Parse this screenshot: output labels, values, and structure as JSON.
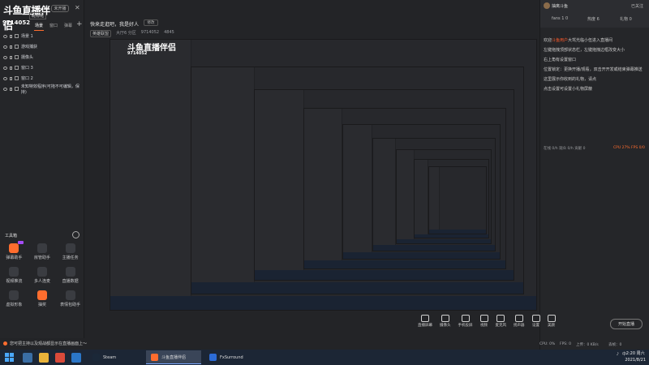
{
  "app": {
    "logo_text": "斗鱼直播伴侣",
    "status_chip": "未开播",
    "user_name": "昵称呢",
    "room_id": "9714052",
    "close_glyph": "✕"
  },
  "scene_tabs": [
    "场景",
    "窗口",
    "弹幕"
  ],
  "add_scene_glyph": "+",
  "sources": [
    {
      "label": "场景 1"
    },
    {
      "label": "游戏捕获"
    },
    {
      "label": "摄像头"
    },
    {
      "label": "窗口 3"
    },
    {
      "label": "窗口 2"
    },
    {
      "label": "未知特效程序(可拖不可编辑，保持)"
    }
  ],
  "toolbox": {
    "title": "工具箱",
    "tools": [
      {
        "label": "弹幕助手",
        "hot": true,
        "badge": true
      },
      {
        "label": "房管助手",
        "hot": false,
        "badge": false
      },
      {
        "label": "主播任务",
        "hot": false,
        "badge": false
      },
      {
        "label": "视频推流",
        "hot": false,
        "badge": false
      },
      {
        "label": "多人连麦",
        "hot": false,
        "badge": false
      },
      {
        "label": "直播数据",
        "hot": false,
        "badge": false
      },
      {
        "label": "虚拟形象",
        "hot": false,
        "badge": false
      },
      {
        "label": "抽奖",
        "hot": true,
        "badge": false
      },
      {
        "label": "表情包助手",
        "hot": false,
        "badge": false
      }
    ]
  },
  "header": {
    "stream_title": "快来走逛吧，我是好人",
    "edit_label": "修改",
    "category": "英雄联盟",
    "meta_items": [
      "大厅6 分区",
      "9714052",
      "4845"
    ]
  },
  "preview": {
    "logo_text": "斗鱼直播伴侣",
    "room_id": "9714052"
  },
  "controls": [
    {
      "label": "直播屏幕",
      "icon": "screen-icon"
    },
    {
      "label": "摄像头",
      "icon": "camera-icon"
    },
    {
      "label": "手机投屏",
      "icon": "phone-icon"
    },
    {
      "label": "视频",
      "icon": "video-icon"
    },
    {
      "label": "麦克风",
      "icon": "mic-icon"
    },
    {
      "label": "扬声器",
      "icon": "speaker-icon"
    },
    {
      "label": "设置",
      "icon": "gear-icon"
    },
    {
      "label": "美颜",
      "icon": "beauty-icon"
    }
  ],
  "start_button": "开始直播",
  "stats": {
    "cpu": "CPU: 0%",
    "fps": "FPS: 0",
    "upload": "上传：0 KB/s",
    "drop": "丢帧：0"
  },
  "right": {
    "streamer": "抽离斗鱼",
    "follow": "已关注",
    "fans": "fans 1 0",
    "hot": "热度 6",
    "gift": "礼物 0"
  },
  "chat": [
    {
      "prefix": "欢迎",
      "highlight": "斗鱼用户",
      "suffix": "大驾光临小伍进入直播间"
    },
    {
      "prefix": "左键拖拽顶部状态栏，左键拖拽边框改变大小",
      "highlight": "",
      "suffix": ""
    },
    {
      "prefix": "右上角有设置窗口",
      "highlight": "",
      "suffix": ""
    },
    {
      "prefix": "位置锁定：更换开播/观看，双击开开发或结束弹幕推送",
      "highlight": "",
      "suffix": ""
    },
    {
      "prefix": "这里展示你收到的礼物，请点",
      "highlight": "",
      "suffix": ""
    },
    {
      "prefix": "点击设置可设置小礼物屏蔽",
      "highlight": "",
      "suffix": ""
    }
  ],
  "chat_stats": {
    "left": "在线 0/h  观众 0/h  贡献 0",
    "right": "CPU 27%  FPS 0/0"
  },
  "footer_tip": "您可把主持以及观战都显示在直播画面上～",
  "taskbar": {
    "apps": [
      {
        "label": "Steam",
        "color": "#1b2838",
        "active": false
      },
      {
        "label": "斗鱼直播伴侣",
        "color": "#ff6d2e",
        "active": true
      },
      {
        "label": "FxSurround",
        "color": "#2c6bd6",
        "active": false
      }
    ],
    "tray_text": "中",
    "time": "2:20 周六",
    "date": "2021/8/21"
  }
}
